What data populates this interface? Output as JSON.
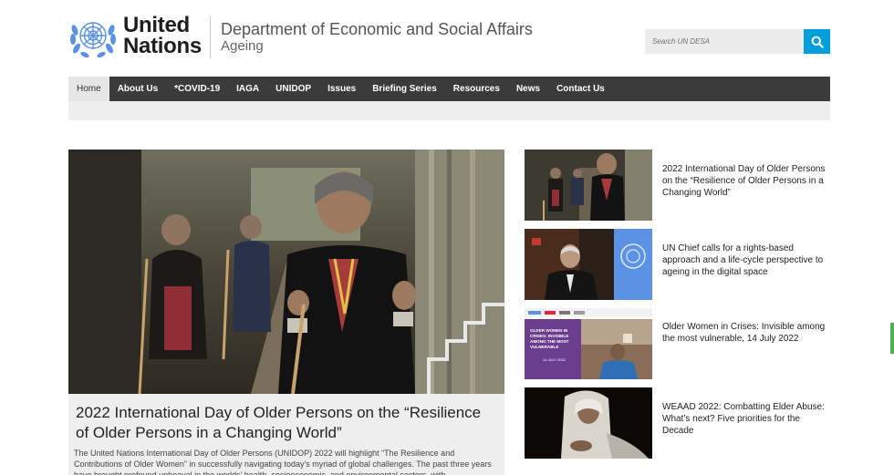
{
  "header": {
    "brand_line1": "United",
    "brand_line2": "Nations",
    "department": "Department of Economic and Social Affairs",
    "subtitle": "Ageing",
    "search_placeholder": "Search UN DESA"
  },
  "nav": {
    "items": [
      {
        "label": "Home",
        "active": true
      },
      {
        "label": "About Us"
      },
      {
        "label": "*COVID-19"
      },
      {
        "label": "IAGA"
      },
      {
        "label": "UNIDOP"
      },
      {
        "label": "Issues"
      },
      {
        "label": "Briefing Series"
      },
      {
        "label": "Resources"
      },
      {
        "label": "News"
      },
      {
        "label": "Contact Us"
      }
    ]
  },
  "feature": {
    "title": "2022 International Day of Older Persons on the “Resilience of Older Persons in a Changing World”",
    "body": "The United Nations International Day of Older Persons (UNIDOP) 2022 will highlight “The Resilience and Contributions of Older Women” in successfully navigating today’s myriad of global challenges. The past three years have brought profound upheaval in the worlds’ health, socioeconomic, and environmental sectors, with"
  },
  "side": [
    {
      "title": "2022 International Day of Older Persons on the “Resilience of Older Persons in a Changing World”"
    },
    {
      "title": "UN Chief calls for a rights-based approach and a life-cycle perspective to ageing in the digital space"
    },
    {
      "title": "Older Women in Crises: Invisible among the most vulnerable, 14 July 2022",
      "thumb_text": "OLDER WOMEN IN CRISES: INVISIBLE AMONG THE MOST VULNERABLE",
      "thumb_date": "14 JULY 2022"
    },
    {
      "title": "WEAAD 2022: Combatting Elder Abuse: What’s next? Five priorities for the Decade"
    }
  ],
  "colors": {
    "accent": "#009edb",
    "nav_bg": "#3b3b3b",
    "un_blue": "#5b92e5",
    "thumb_purple": "#6a3d8f"
  }
}
